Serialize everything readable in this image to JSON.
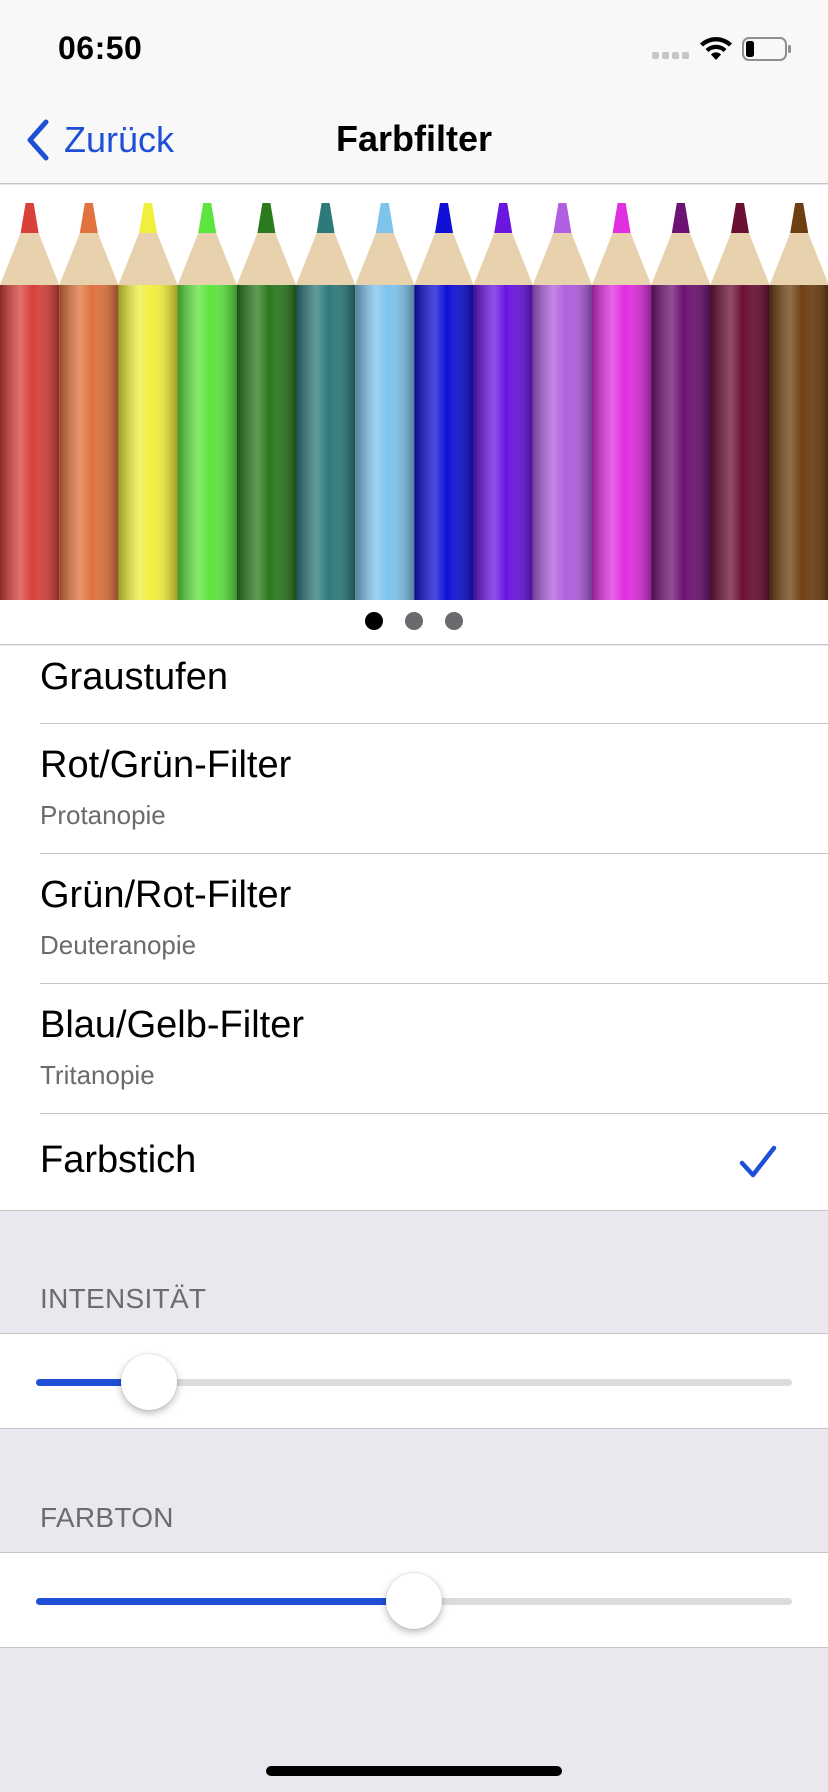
{
  "status_bar": {
    "time": "06:50"
  },
  "nav": {
    "back_label": "Zurück",
    "title": "Farbfilter"
  },
  "hero": {
    "pencil_colors": [
      "#d8403a",
      "#e0733f",
      "#f0ef3d",
      "#5ee43f",
      "#2b7a1e",
      "#2d7a7a",
      "#7ec3ec",
      "#1010d6",
      "#6a15e0",
      "#b05fe0",
      "#e02ee0",
      "#6e1273",
      "#6b0f35",
      "#6e3f12"
    ],
    "page_count": 3,
    "active_page": 0
  },
  "filters": [
    {
      "title": "Graustufen",
      "subtitle": "",
      "selected": false
    },
    {
      "title": "Rot/Grün-Filter",
      "subtitle": "Protanopie",
      "selected": false
    },
    {
      "title": "Grün/Rot-Filter",
      "subtitle": "Deuteranopie",
      "selected": false
    },
    {
      "title": "Blau/Gelb-Filter",
      "subtitle": "Tritanopie",
      "selected": false
    },
    {
      "title": "Farbstich",
      "subtitle": "",
      "selected": true
    }
  ],
  "intensity": {
    "header": "INTENSITÄT",
    "value": 0.15
  },
  "hue": {
    "header": "FARBTON",
    "value": 0.5
  },
  "colors": {
    "accent": "#1f4fd6"
  }
}
